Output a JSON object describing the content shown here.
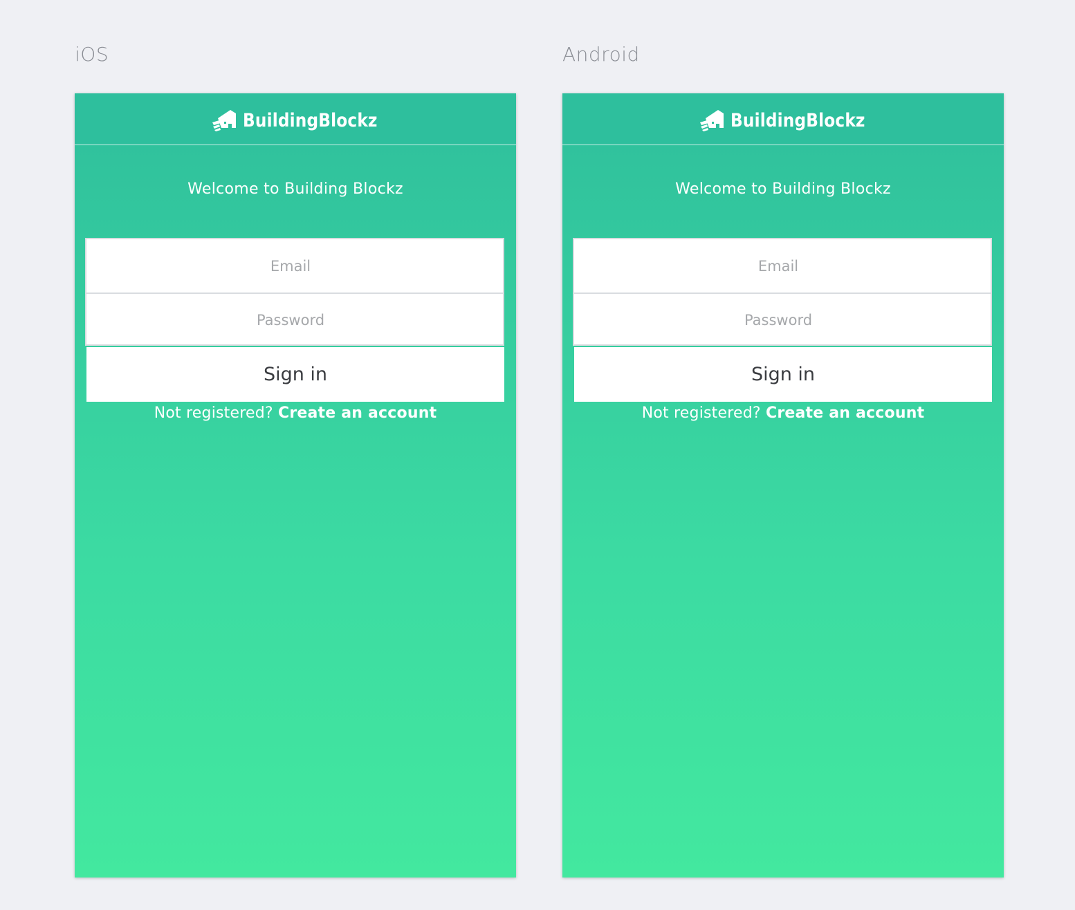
{
  "platforms": [
    {
      "label": "iOS",
      "app": {
        "brand": "BuildingBlockz",
        "welcome": "Welcome to Building Blockz",
        "email_placeholder": "Email",
        "password_placeholder": "Password",
        "signin_label": "Sign in",
        "register_prompt": "Not registered?",
        "register_link": "Create an account"
      }
    },
    {
      "label": "Android",
      "app": {
        "brand": "BuildingBlockz",
        "welcome": "Welcome to Building Blockz",
        "email_placeholder": "Email",
        "password_placeholder": "Password",
        "signin_label": "Sign in",
        "register_prompt": "Not registered?",
        "register_link": "Create an account"
      }
    }
  ],
  "colors": {
    "page_background": "#eff0f4",
    "header": "#2ebf9d",
    "gradient_top": "#2fbf9c",
    "gradient_bottom": "#43e89f",
    "text_on_green": "#ffffff",
    "placeholder": "#a6a8ab"
  },
  "icons": {
    "logo": "hand-holding-house-icon"
  }
}
